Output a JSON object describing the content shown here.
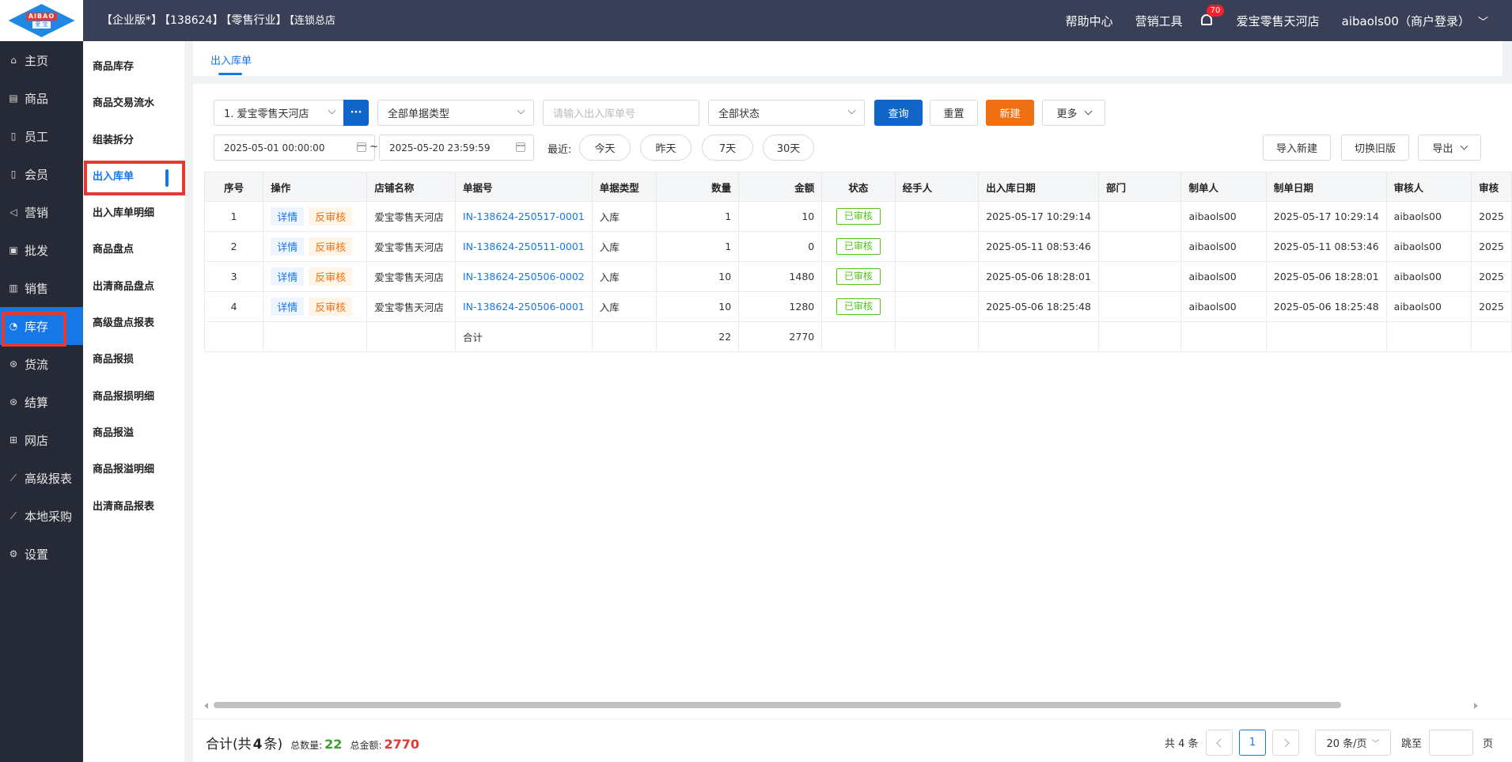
{
  "header": {
    "logo_top": "AIBAO",
    "logo_bottom": "爱 宝",
    "edition": "【企业版*】",
    "account_id": "【138624】",
    "industry": "【零售行业】",
    "store_type": "【连锁总店",
    "help": "帮助中心",
    "marketing": "营销工具",
    "notifications": "70",
    "store": "爱宝零售天河店",
    "user": "aibaols00（商户登录）"
  },
  "sidebar": {
    "items": [
      {
        "label": "主页",
        "icon": "home-icon"
      },
      {
        "label": "商品",
        "icon": "goods-icon"
      },
      {
        "label": "员工",
        "icon": "staff-icon"
      },
      {
        "label": "会员",
        "icon": "member-icon"
      },
      {
        "label": "营销",
        "icon": "megaphone-icon"
      },
      {
        "label": "批发",
        "icon": "wholesale-icon"
      },
      {
        "label": "销售",
        "icon": "sales-chart-icon"
      },
      {
        "label": "库存",
        "icon": "inventory-icon"
      },
      {
        "label": "货流",
        "icon": "logistics-icon"
      },
      {
        "label": "结算",
        "icon": "settlement-icon"
      },
      {
        "label": "网店",
        "icon": "gift-icon"
      },
      {
        "label": "高级报表",
        "icon": "line-chart-icon"
      },
      {
        "label": "本地采购",
        "icon": "purchase-icon"
      },
      {
        "label": "设置",
        "icon": "gear-icon"
      }
    ],
    "active_index": 7
  },
  "subnav": {
    "items": [
      "商品库存",
      "商品交易流水",
      "组装拆分",
      "出入库单",
      "出入库单明细",
      "商品盘点",
      "出清商品盘点",
      "高级盘点报表",
      "商品报损",
      "商品报损明细",
      "商品报溢",
      "商品报溢明细",
      "出清商品报表"
    ],
    "active_index": 3
  },
  "tabs": {
    "active": "出入库单"
  },
  "filters": {
    "store": "1. 爱宝零售天河店",
    "store_more": "···",
    "doc_type": "全部单据类型",
    "doc_no_placeholder": "请输入出入库单号",
    "status": "全部状态",
    "query": "查询",
    "reset": "重置",
    "create": "新建",
    "more": "更多",
    "date_start": "2025-05-01 00:00:00",
    "date_sep": "~",
    "date_end": "2025-05-20 23:59:59",
    "recent_label": "最近:",
    "quick": [
      "今天",
      "昨天",
      "7天",
      "30天"
    ],
    "import_new": "导入新建",
    "switch_old": "切换旧版",
    "export": "导出"
  },
  "table": {
    "headers": [
      "序号",
      "操作",
      "店铺名称",
      "单据号",
      "单据类型",
      "数量",
      "金额",
      "状态",
      "经手人",
      "出入库日期",
      "部门",
      "制单人",
      "制单日期",
      "审核人",
      "审核"
    ],
    "op_detail": "详情",
    "op_reverse": "反审核",
    "rows": [
      {
        "no": "1",
        "store": "爱宝零售天河店",
        "doc": "IN-138624-250517-0001",
        "type": "入库",
        "qty": "1",
        "amount": "10",
        "status": "已审核",
        "handler": "",
        "date": "2025-05-17 10:29:14",
        "dept": "",
        "maker": "aibaols00",
        "made": "2025-05-17 10:29:14",
        "auditor": "aibaols00",
        "audit": "2025"
      },
      {
        "no": "2",
        "store": "爱宝零售天河店",
        "doc": "IN-138624-250511-0001",
        "type": "入库",
        "qty": "1",
        "amount": "0",
        "status": "已审核",
        "handler": "",
        "date": "2025-05-11 08:53:46",
        "dept": "",
        "maker": "aibaols00",
        "made": "2025-05-11 08:53:46",
        "auditor": "aibaols00",
        "audit": "2025"
      },
      {
        "no": "3",
        "store": "爱宝零售天河店",
        "doc": "IN-138624-250506-0002",
        "type": "入库",
        "qty": "10",
        "amount": "1480",
        "status": "已审核",
        "handler": "",
        "date": "2025-05-06 18:28:01",
        "dept": "",
        "maker": "aibaols00",
        "made": "2025-05-06 18:28:01",
        "auditor": "aibaols00",
        "audit": "2025"
      },
      {
        "no": "4",
        "store": "爱宝零售天河店",
        "doc": "IN-138624-250506-0001",
        "type": "入库",
        "qty": "10",
        "amount": "1280",
        "status": "已审核",
        "handler": "",
        "date": "2025-05-06 18:25:48",
        "dept": "",
        "maker": "aibaols00",
        "made": "2025-05-06 18:25:48",
        "auditor": "aibaols00",
        "audit": "2025"
      }
    ],
    "total_label": "合计",
    "total_qty": "22",
    "total_amount": "2770"
  },
  "footer": {
    "summary_prefix": "合计(共",
    "summary_count": "4",
    "summary_suffix": "条)",
    "qty_label": "总数量:",
    "qty_value": "22",
    "amount_label": "总金额:",
    "amount_value": "2770",
    "total_records": "共 4 条",
    "current_page": "1",
    "page_size": "20 条/页",
    "jump_label": "跳至",
    "page_unit": "页"
  },
  "colors": {
    "primary": "#1065c8",
    "accent_orange": "#f07113",
    "header_bg": "#3a3f58",
    "sidebar_bg": "#262a36",
    "highlight_red": "#e53935"
  }
}
